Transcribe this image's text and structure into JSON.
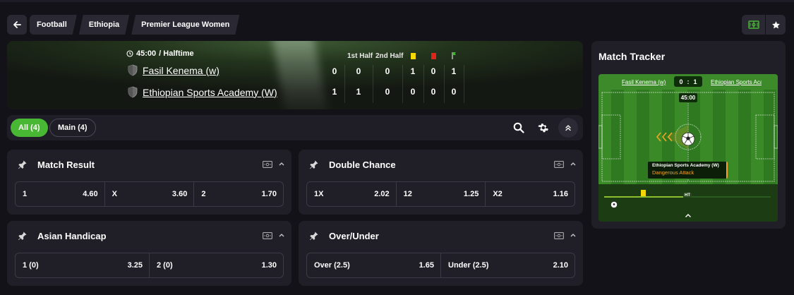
{
  "breadcrumb": {
    "back_icon": "arrow-left-icon",
    "items": [
      "Football",
      "Ethiopia",
      "Premier League Women"
    ]
  },
  "top_actions": {
    "pitch_icon": "pitch-icon",
    "favorite_icon": "star-icon"
  },
  "scoreboard": {
    "time": "45:00",
    "status": "/ Halftime",
    "columns": [
      "1st Half",
      "2nd Half"
    ],
    "column_icons": [
      "yellow-card-icon",
      "red-card-icon",
      "corner-flag-icon"
    ],
    "colors": {
      "yellow_card": "#f5d800",
      "red_card": "#e0241a",
      "corner_flag": "#48b734"
    },
    "teams": [
      {
        "name": "Fasil Kenema (w)",
        "score": "0",
        "first_half": "0",
        "second_half": "0",
        "yellow": "1",
        "red": "0",
        "corners": "1"
      },
      {
        "name": "Ethiopian Sports Academy (W)",
        "score": "1",
        "first_half": "1",
        "second_half": "0",
        "yellow": "0",
        "red": "0",
        "corners": "0"
      }
    ]
  },
  "filters": {
    "tabs": [
      {
        "label": "All (4)",
        "active": true
      },
      {
        "label": "Main (4)",
        "active": false
      }
    ],
    "accent": "#48b734"
  },
  "markets": [
    {
      "title": "Match Result",
      "odds": [
        {
          "label": "1",
          "value": "4.60"
        },
        {
          "label": "X",
          "value": "3.60"
        },
        {
          "label": "2",
          "value": "1.70"
        }
      ]
    },
    {
      "title": "Double Chance",
      "odds": [
        {
          "label": "1X",
          "value": "2.02"
        },
        {
          "label": "12",
          "value": "1.25"
        },
        {
          "label": "X2",
          "value": "1.16"
        }
      ]
    },
    {
      "title": "Asian Handicap",
      "odds": [
        {
          "label": "1 (0)",
          "value": "3.25"
        },
        {
          "label": "2 (0)",
          "value": "1.30"
        }
      ]
    },
    {
      "title": "Over/Under",
      "odds": [
        {
          "label": "Over (2.5)",
          "value": "1.65"
        },
        {
          "label": "Under (2.5)",
          "value": "2.10"
        }
      ]
    }
  ],
  "tracker": {
    "title": "Match Tracker",
    "home": "Fasil Kenema (w)",
    "home_score": "0",
    "separator": ":",
    "away_score": "1",
    "away": "Ethiopian Sports Academy ...",
    "clock": "45:00",
    "event_team": "Ethiopian Sports Academy (W)",
    "event": "Dangerous Attack",
    "timeline_label": "HT",
    "match_progress": 0.5
  }
}
